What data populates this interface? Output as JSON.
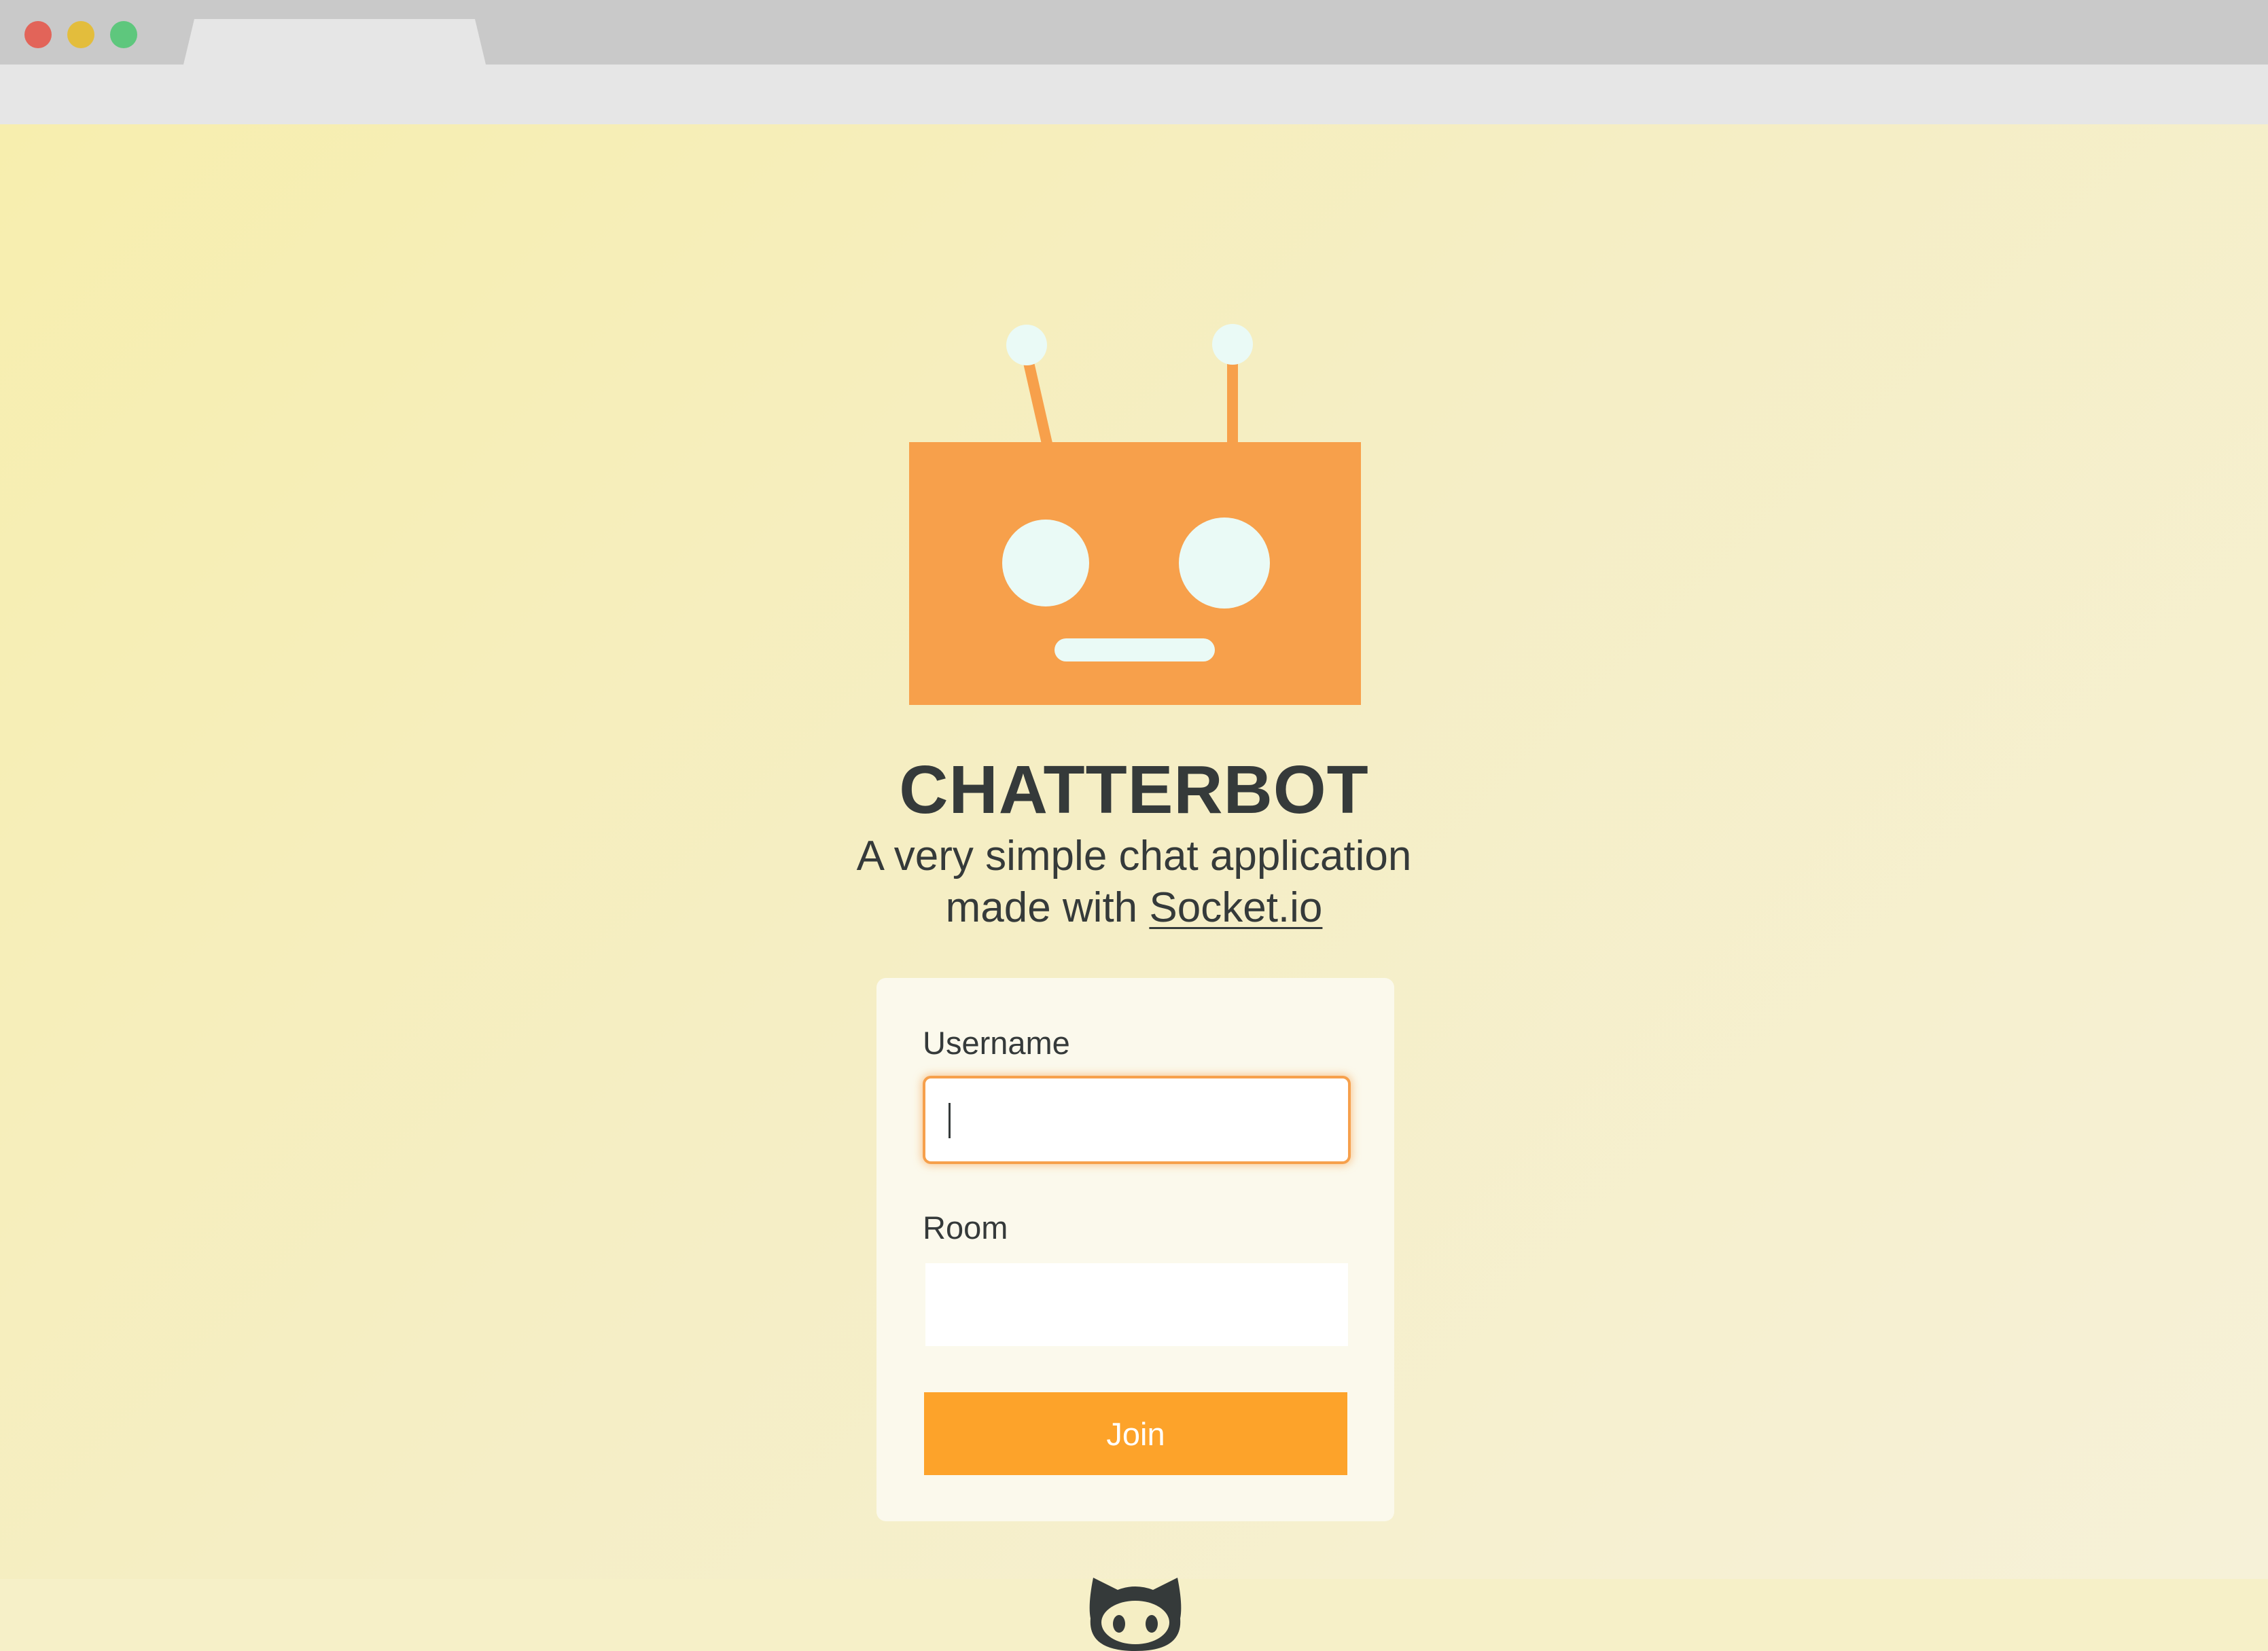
{
  "browser": {
    "traffic_lights": [
      {
        "name": "close",
        "color": "#e26459"
      },
      {
        "name": "minimize",
        "color": "#e3bd3c"
      },
      {
        "name": "maximize",
        "color": "#5ec77d"
      }
    ],
    "tab_title": ""
  },
  "app": {
    "title": "CHATTERBOT",
    "subtitle_line1": "A very simple chat application",
    "subtitle_line2_prefix": "made with ",
    "subtitle_link": "Socket.io"
  },
  "form": {
    "username_label": "Username",
    "username_value": "",
    "room_label": "Room",
    "room_value": "",
    "join_label": "Join"
  },
  "colors": {
    "robot_orange": "#f7a04b",
    "robot_eye": "#eafaf6",
    "button_orange": "#fda32a",
    "text_dark": "#353a3a",
    "card_bg": "#fbf9ec"
  },
  "icons": {
    "logo": "robot-head-icon",
    "footer": "github-octocat-icon"
  }
}
